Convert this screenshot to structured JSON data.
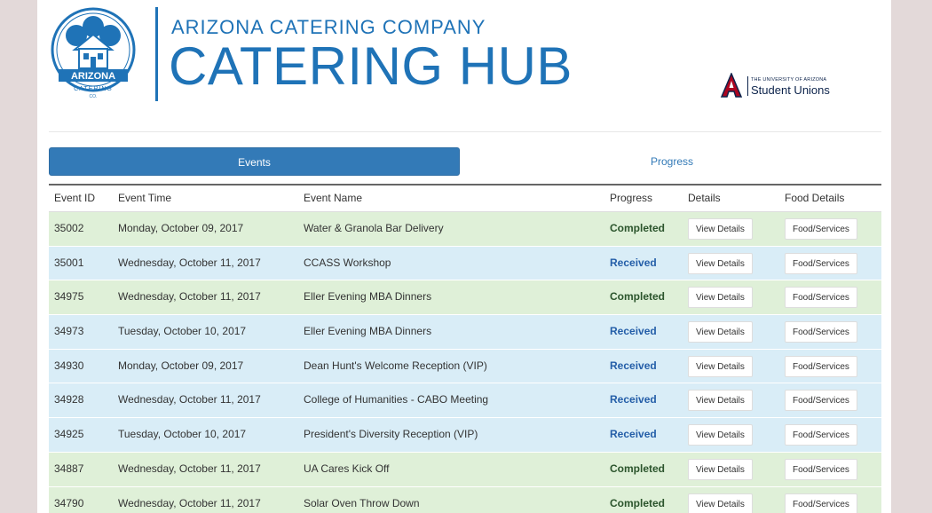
{
  "header": {
    "logo": {
      "line1": "ARIZONA",
      "line2": "CATERING",
      "line3": "CO."
    },
    "company": "ARIZONA CATERING COMPANY",
    "title": "CATERING HUB",
    "partner": {
      "small": "THE UNIVERSITY OF ARIZONA",
      "big": "Student Unions"
    }
  },
  "tabs": [
    {
      "label": "Events",
      "active": true
    },
    {
      "label": "Progress",
      "active": false
    }
  ],
  "table": {
    "columns": [
      "Event ID",
      "Event Time",
      "Event Name",
      "Progress",
      "Details",
      "Food Details"
    ],
    "details_label": "View Details",
    "food_label": "Food/Services",
    "rows": [
      {
        "id": "35002",
        "time": "Monday, October 09, 2017",
        "name": "Water & Granola Bar Delivery",
        "progress": "Completed"
      },
      {
        "id": "35001",
        "time": "Wednesday, October 11, 2017",
        "name": "CCASS Workshop",
        "progress": "Received"
      },
      {
        "id": "34975",
        "time": "Wednesday, October 11, 2017",
        "name": "Eller Evening MBA Dinners",
        "progress": "Completed"
      },
      {
        "id": "34973",
        "time": "Tuesday, October 10, 2017",
        "name": "Eller Evening MBA Dinners",
        "progress": "Received"
      },
      {
        "id": "34930",
        "time": "Monday, October 09, 2017",
        "name": "Dean Hunt's Welcome Reception (VIP)",
        "progress": "Received"
      },
      {
        "id": "34928",
        "time": "Wednesday, October 11, 2017",
        "name": "College of Humanities - CABO Meeting",
        "progress": "Received"
      },
      {
        "id": "34925",
        "time": "Tuesday, October 10, 2017",
        "name": "President's Diversity Reception (VIP)",
        "progress": "Received"
      },
      {
        "id": "34887",
        "time": "Wednesday, October 11, 2017",
        "name": "UA Cares Kick Off",
        "progress": "Completed"
      },
      {
        "id": "34790",
        "time": "Wednesday, October 11, 2017",
        "name": "Solar Oven Throw Down",
        "progress": "Completed"
      }
    ]
  },
  "colors": {
    "brand_blue": "#1f73b7",
    "completed_row": "#dff0d8",
    "received_row": "#d9edf7",
    "completed_text": "#2b542c",
    "received_text": "#245ea8"
  }
}
